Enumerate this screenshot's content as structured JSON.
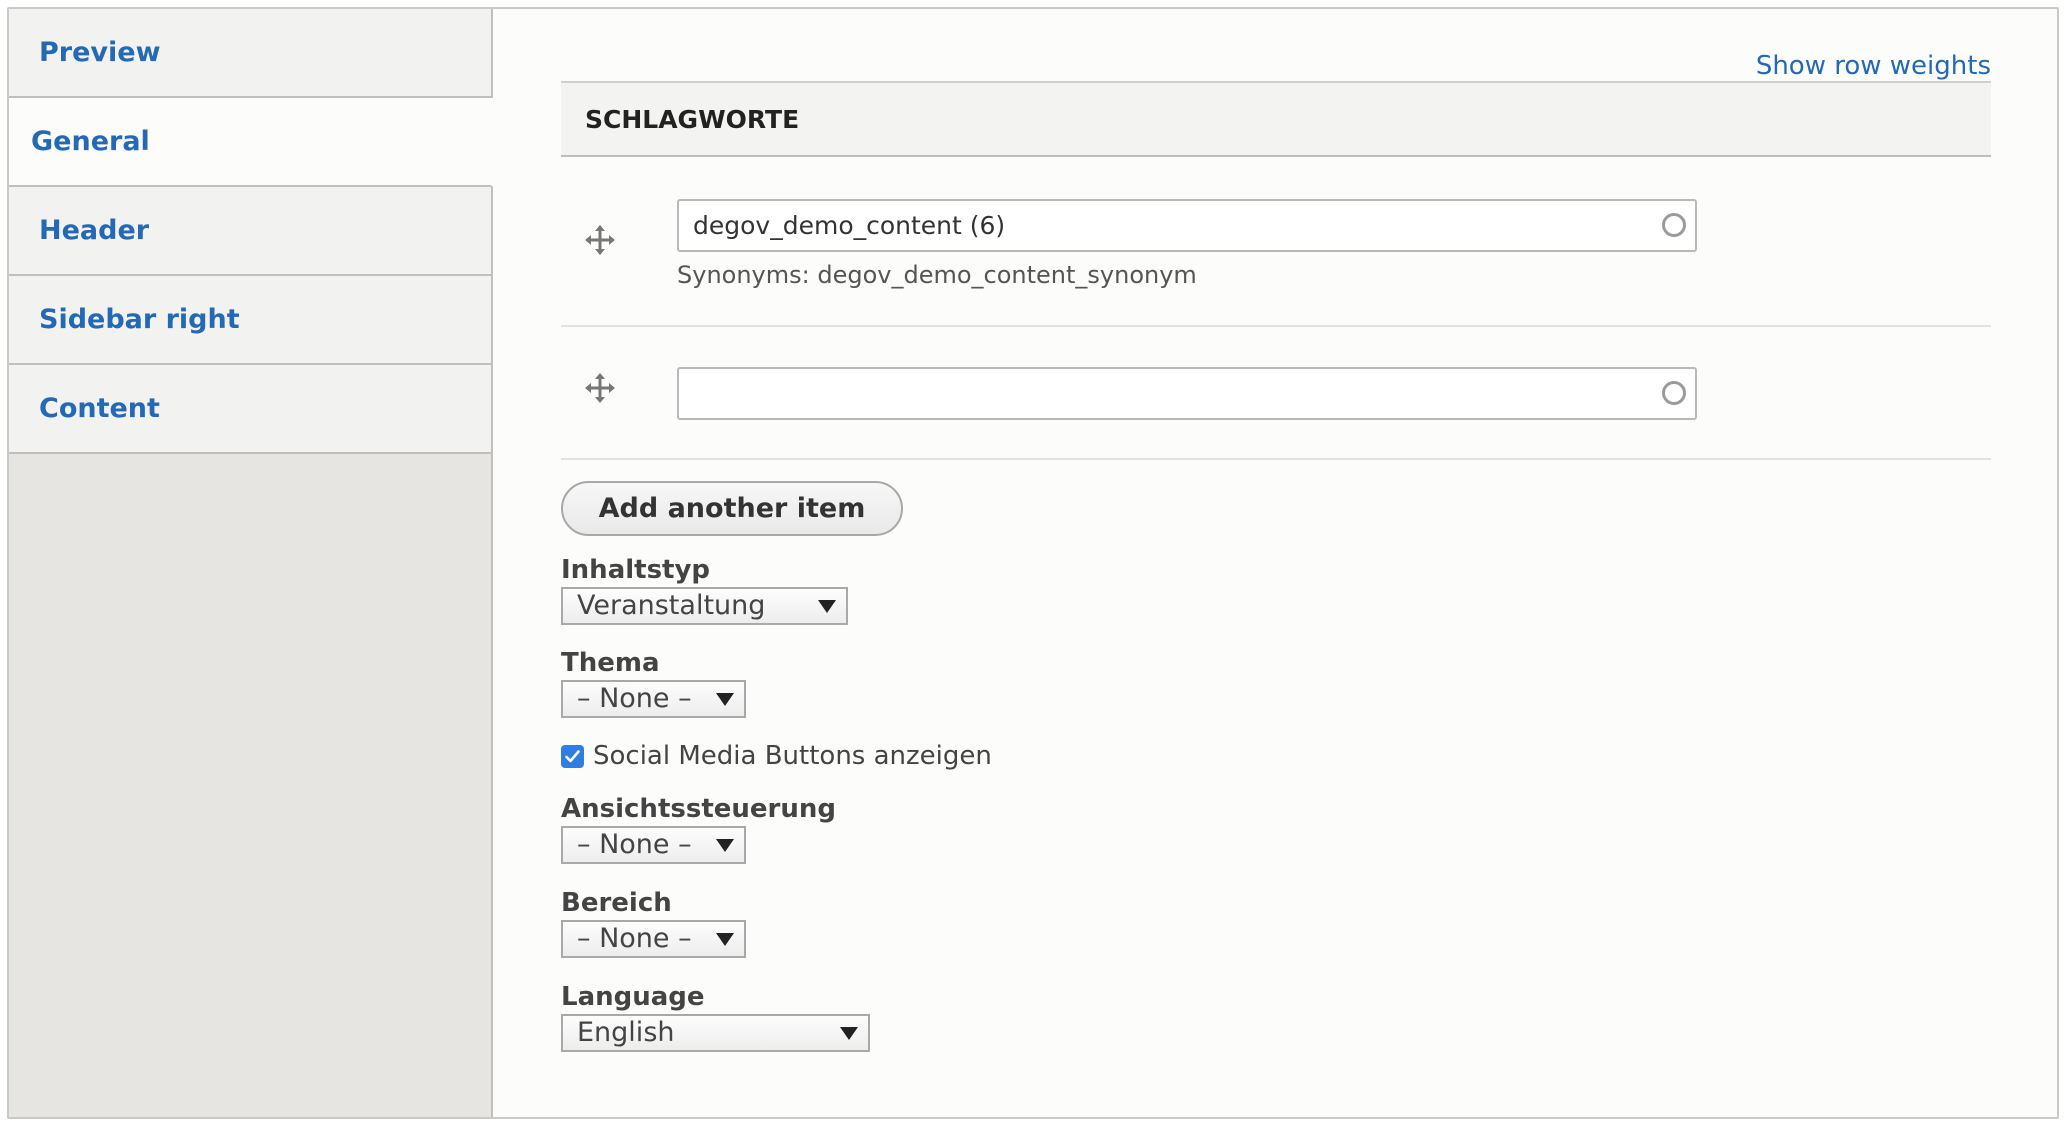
{
  "tabs": [
    {
      "label": "Preview",
      "selected": false
    },
    {
      "label": "General",
      "selected": true
    },
    {
      "label": "Header",
      "selected": false
    },
    {
      "label": "Sidebar right",
      "selected": false
    },
    {
      "label": "Content",
      "selected": false
    }
  ],
  "table": {
    "show_weights_label": "Show row weights",
    "header": "SCHLAGWORTE",
    "rows": [
      {
        "value": "degov_demo_content (6)",
        "description": "Synonyms: degov_demo_content_synonym"
      },
      {
        "value": "",
        "description": ""
      }
    ]
  },
  "add_button_label": "Add another item",
  "fields": {
    "inhaltstyp": {
      "label": "Inhaltstyp",
      "value": "Veranstaltung"
    },
    "thema": {
      "label": "Thema",
      "value": "– None –"
    },
    "social_media": {
      "label": "Social Media Buttons anzeigen",
      "checked": true
    },
    "ansicht": {
      "label": "Ansichtssteuerung",
      "value": "– None –"
    },
    "bereich": {
      "label": "Bereich",
      "value": "– None –"
    },
    "language": {
      "label": "Language",
      "value": "English"
    }
  },
  "colors": {
    "link": "#2469b5",
    "checkbox": "#2f7de0",
    "sidebar_bg": "#e6e5e1",
    "panel_bg": "#fcfcfa"
  },
  "icons": {
    "drag": "drag-handle-icon",
    "throbber": "autocomplete-throbber-icon",
    "dropdown": "dropdown-arrow-icon",
    "check": "checkmark-icon"
  }
}
